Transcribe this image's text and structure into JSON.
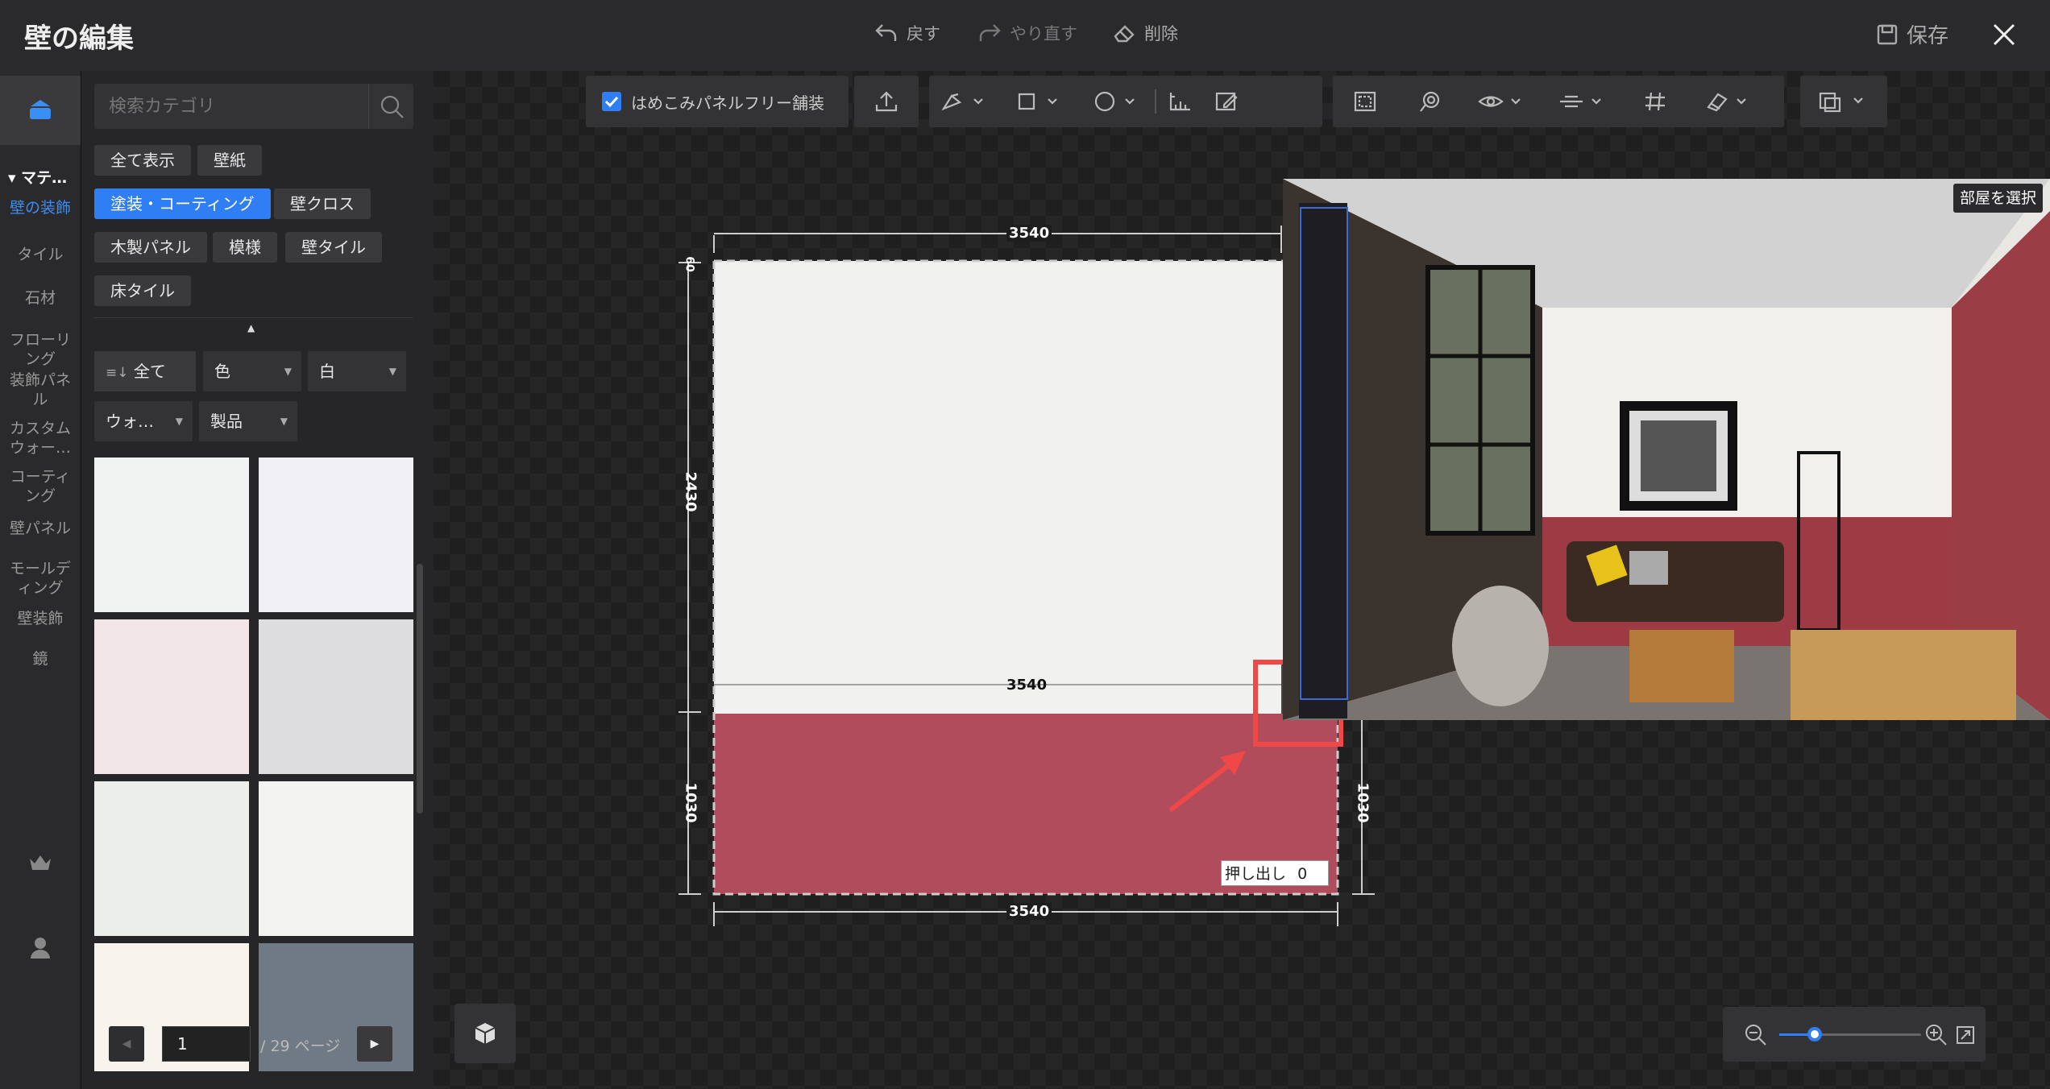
{
  "header": {
    "title": "壁の編集",
    "undo_label": "戻す",
    "redo_label": "やり直す",
    "delete_label": "削除",
    "save_label": "保存"
  },
  "left_nav": {
    "section_label": "マテ…",
    "items": [
      "壁の装飾",
      "タイル",
      "石材",
      "フローリング",
      "装飾パネル",
      "カスタムウォー…",
      "コーティング",
      "壁パネル",
      "モールディング",
      "壁装飾",
      "鏡"
    ],
    "items_display": [
      "壁の装飾",
      "タイル",
      "石材",
      "フローリ\nング",
      "装飾パネ\nル",
      "カスタム\nウォー…",
      "コーティ\nング",
      "壁パネル",
      "モールデ\nィング",
      "壁装飾",
      "鏡"
    ],
    "active_index": 0
  },
  "panel": {
    "search_placeholder": "検索カテゴリ",
    "chips": [
      "全て表示",
      "壁紙",
      "塗装・コーティング",
      "壁クロス",
      "木製パネル",
      "模様",
      "壁タイル",
      "床タイル"
    ],
    "active_chip_index": 2,
    "filter_all": "全て",
    "filter_color": "色",
    "filter_color_value": "白",
    "filter_type": "ウォ…",
    "filter_product": "製品",
    "swatches": [
      "#f1f2f2",
      "#f0f0f4",
      "#f3e6e8",
      "#dddde0",
      "#eceeeb",
      "#f3f4f2",
      "#f7f4ee",
      "#6f7a85"
    ],
    "pagination": {
      "current": "1",
      "total_label": "/ 29 ページ"
    }
  },
  "toolbar": {
    "checkbox_label": "はめこみパネルフリー舗装",
    "checkbox_checked": true
  },
  "drawing": {
    "top_width": "3540",
    "mid_width": "3540",
    "bottom_width": "3540",
    "upper_height": "2430",
    "lower_height": "1030",
    "right_height": "1030",
    "top_small": "60",
    "extrude_label": "押し出し",
    "extrude_value": "0",
    "wall_upper_color": "#f1f2ef",
    "wall_lower_color": "#b14c5c"
  },
  "preview": {
    "select_room_label": "部屋を選択"
  },
  "zoom": {
    "level": 0.25
  }
}
